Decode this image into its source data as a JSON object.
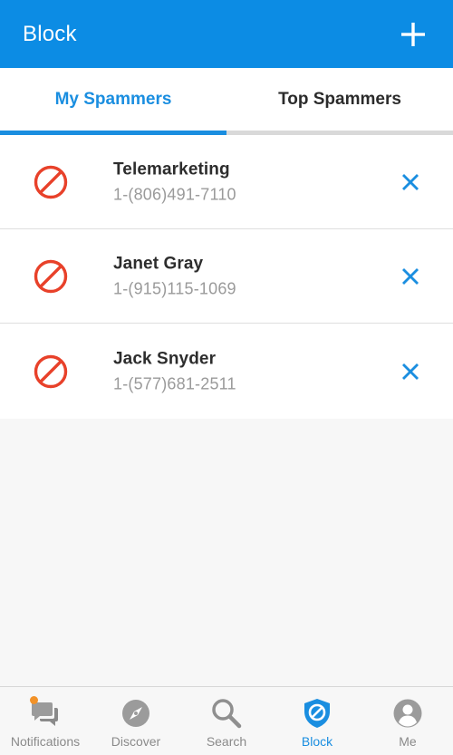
{
  "appbar": {
    "title": "Block",
    "add_icon": "plus-icon"
  },
  "tabs": [
    {
      "label": "My Spammers",
      "active": true
    },
    {
      "label": "Top Spammers",
      "active": false
    }
  ],
  "spammers": [
    {
      "name": "Telemarketing",
      "phone": "1-(806)491-7110"
    },
    {
      "name": "Janet Gray",
      "phone": "1-(915)115-1069"
    },
    {
      "name": "Jack Snyder",
      "phone": "1-(577)681-2511"
    }
  ],
  "nav": [
    {
      "label": "Notifications",
      "icon": "chat-bubbles-icon"
    },
    {
      "label": "Discover",
      "icon": "compass-icon"
    },
    {
      "label": "Search",
      "icon": "magnifier-icon"
    },
    {
      "label": "Block",
      "icon": "shield-block-icon"
    },
    {
      "label": "Me",
      "icon": "person-icon"
    }
  ],
  "colors": {
    "primary": "#0c8ce4",
    "accent": "#1a8ee0",
    "block_red": "#e8412a",
    "badge": "#f29228"
  }
}
